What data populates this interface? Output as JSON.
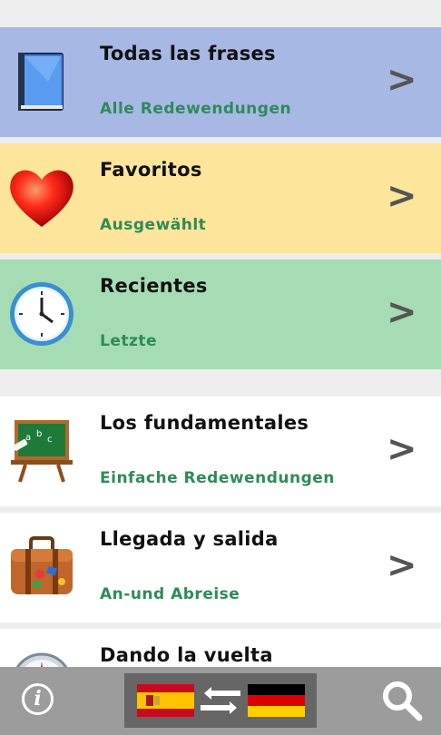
{
  "rows": [
    {
      "title": "Todas las frases",
      "subtitle": "Alle Redewendungen",
      "icon": "book-icon",
      "bg": "#a8b8e4"
    },
    {
      "title": "Favoritos",
      "subtitle": "Ausgewählt",
      "icon": "heart-icon",
      "bg": "#fde69c"
    },
    {
      "title": "Recientes",
      "subtitle": "Letzte",
      "icon": "clock-icon",
      "bg": "#a6dcb4"
    },
    {
      "title": "Los fundamentales",
      "subtitle": "Einfache Redewendungen",
      "icon": "chalkboard-icon",
      "bg": "#ffffff"
    },
    {
      "title": "Llegada y salida",
      "subtitle": "An-und Abreise",
      "icon": "suitcase-icon",
      "bg": "#ffffff"
    },
    {
      "title": "Dando la vuelta",
      "subtitle": "",
      "icon": "compass-icon",
      "bg": "#ffffff"
    }
  ],
  "chevron": ">",
  "bottom_bar": {
    "info_label": "i",
    "source_language": "Spanish",
    "target_language": "German",
    "swap_icon": "swap-arrows-icon",
    "search_icon": "search-icon"
  },
  "colors": {
    "subtitle": "#2e8b57",
    "chevron": "#555555",
    "bottom_bar": "#9c9c9c"
  }
}
